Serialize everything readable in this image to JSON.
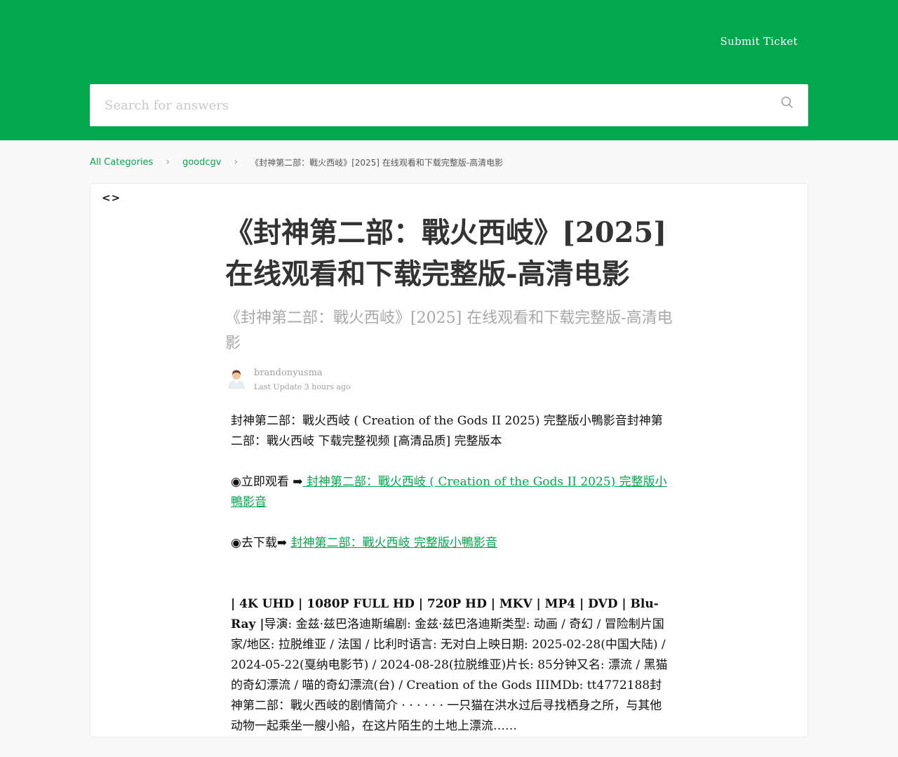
{
  "header": {
    "submit_ticket": "Submit Ticket",
    "search_placeholder": "Search for answers"
  },
  "breadcrumb": {
    "items": [
      "All Categories",
      "goodcgv"
    ],
    "current": "《封神第二部：戰火西岐》[2025] 在线观看和下载完整版-高清电影"
  },
  "article": {
    "title": "《封神第二部：戰火西岐》[2025] 在线观看和下载完整版-高清电影",
    "subtitle": "《封神第二部：戰火西岐》[2025] 在线观看和下载完整版-高清电影",
    "author": "brandonyusma",
    "last_update": "Last Update 3 hours ago",
    "intro": "封神第二部：戰火西岐 ( Creation of the Gods II 2025) 完整版小鴨影音封神第二部：戰火西岐 下载完整视频 [高清品质] 完整版本",
    "watch_prefix": "◉立即观看 ➡",
    "watch_link": " 封神第二部：戰火西岐 ( Creation of the Gods II 2025) 完整版小鴨影音",
    "download_prefix": "◉去下载➡ ",
    "download_link": "封神第二部：戰火西岐 完整版小鴨影音",
    "formats": "| 4K UHD | 1080P FULL HD | 720P HD | MKV | MP4 | DVD | Blu-Ray |",
    "details": "导演: 金兹·兹巴洛迪斯编剧: 金兹·兹巴洛迪斯类型: 动画 / 奇幻 / 冒险制片国家/地区: 拉脱维亚 / 法国 / 比利时语言: 无对白上映日期: 2025-02-28(中国大陆) / 2024-05-22(戛纳电影节) / 2024-08-28(拉脱维亚)片长: 85分钟又名: 漂流 / 黑猫的奇幻漂流 / 喵的奇幻漂流(台) / Creation of the Gods IIIMDb: tt4772188封神第二部：戰火西岐的剧情简介 · · · · · · 一只猫在洪水过后寻找栖身之所，与其他动物一起乘坐一艘小船，在这片陌生的土地上漂流……"
  },
  "colors": {
    "brand": "#03a84e"
  },
  "icons": {
    "search": "search-icon",
    "toggle": "code-brackets-icon",
    "avatar": "avatar-icon",
    "breadcrumb_sep": "chevron-right-icon"
  }
}
